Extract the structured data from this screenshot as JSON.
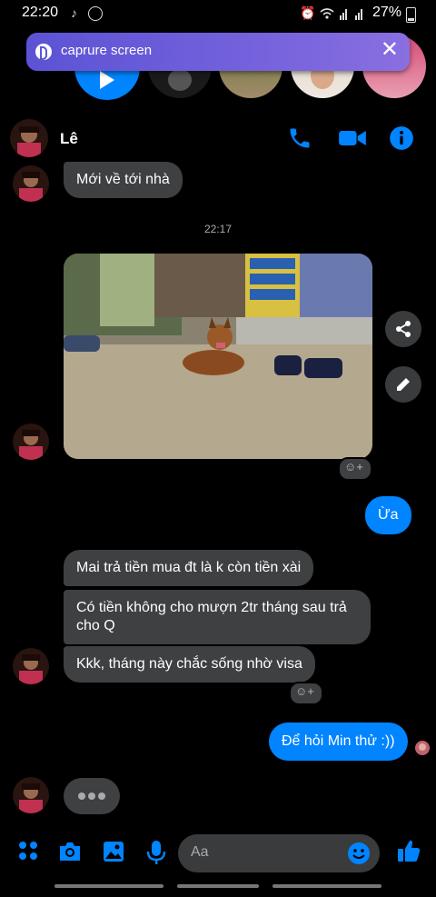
{
  "status_bar": {
    "time": "22:20",
    "battery": "27%"
  },
  "banner": {
    "text": "caprure screen"
  },
  "header": {
    "name": "Lê"
  },
  "timestamp": "22:17",
  "messages": {
    "m1": "Mới về tới nhà",
    "m2": "Ừa",
    "m3": "Mai trả tiền mua đt là k còn tiền xài",
    "m4": "Có tiền không cho mượn 2tr tháng sau trả cho Q",
    "m5": "Kkk, tháng này chắc sống nhờ visa",
    "m6": "Để hỏi Min thử :))"
  },
  "composer": {
    "placeholder": "Aa"
  },
  "colors": {
    "accent": "#0084ff",
    "received_bubble": "#3e4042",
    "banner": "#6a5be0"
  },
  "icons": [
    "tiktok-icon",
    "messenger-icon",
    "alarm-icon",
    "wifi-icon",
    "signal-icon",
    "battery-icon",
    "bixby-icon",
    "close-icon",
    "phone-icon",
    "video-icon",
    "info-icon",
    "share-icon",
    "edit-icon",
    "reaction-icon",
    "apps-icon",
    "camera-icon",
    "gallery-icon",
    "mic-icon",
    "emoji-icon",
    "thumbs-up-icon"
  ]
}
